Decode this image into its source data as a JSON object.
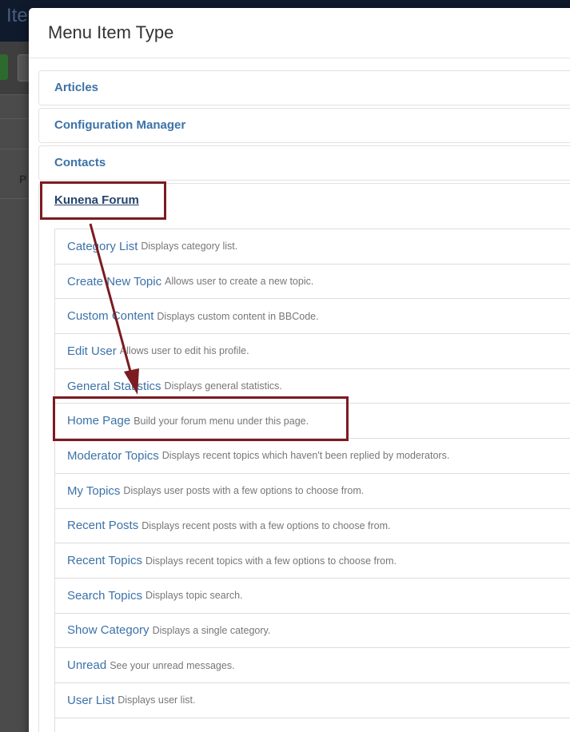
{
  "background": {
    "header_title": "Ite",
    "row_letter": "P"
  },
  "modal": {
    "title": "Menu Item Type",
    "groups": [
      {
        "label": "Articles"
      },
      {
        "label": "Configuration Manager"
      },
      {
        "label": "Contacts"
      },
      {
        "label": "Kunena Forum"
      }
    ],
    "kunena_items": [
      {
        "title": "Category List",
        "desc": "Displays category list."
      },
      {
        "title": "Create New Topic",
        "desc": "Allows user to create a new topic."
      },
      {
        "title": "Custom Content",
        "desc": "Displays custom content in BBCode."
      },
      {
        "title": "Edit User",
        "desc": "Allows user to edit his profile."
      },
      {
        "title": "General Statistics",
        "desc": "Displays general statistics."
      },
      {
        "title": "Home Page",
        "desc": "Build your forum menu under this page."
      },
      {
        "title": "Moderator Topics",
        "desc": "Displays recent topics which haven't been replied by moderators."
      },
      {
        "title": "My Topics",
        "desc": "Displays user posts with a few options to choose from."
      },
      {
        "title": "Recent Posts",
        "desc": "Displays recent posts with a few options to choose from."
      },
      {
        "title": "Recent Topics",
        "desc": "Displays recent topics with a few options to choose from."
      },
      {
        "title": "Search Topics",
        "desc": "Displays topic search."
      },
      {
        "title": "Show Category",
        "desc": "Displays a single category."
      },
      {
        "title": "Unread",
        "desc": "See your unread messages."
      },
      {
        "title": "User List",
        "desc": "Displays user list."
      }
    ]
  },
  "colors": {
    "link": "#3c72a8",
    "annotation": "#7b1b22"
  }
}
